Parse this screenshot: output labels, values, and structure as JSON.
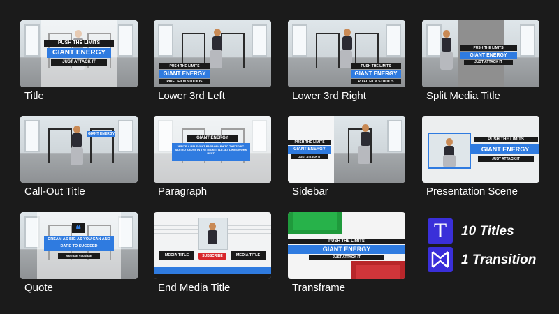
{
  "titles": [
    {
      "caption": "Title"
    },
    {
      "caption": "Lower 3rd Left"
    },
    {
      "caption": "Lower 3rd Right"
    },
    {
      "caption": "Split Media Title"
    },
    {
      "caption": "Call-Out Title"
    },
    {
      "caption": "Paragraph"
    },
    {
      "caption": "Sidebar"
    },
    {
      "caption": "Presentation Scene"
    },
    {
      "caption": "Quote"
    },
    {
      "caption": "End Media Title"
    },
    {
      "caption": "Transframe"
    }
  ],
  "overlay": {
    "line1": "PUSH THE LIMITS",
    "line2": "GIANT ENERGY",
    "line3": "JUST ATTACK IT",
    "studio": "PIXEL FILM STUDIOS",
    "paragraph_body": "WRITE A RELEVANT PARAGRAPH TO THE TOPIC STATED ABOVE IN THE MAIN TITLE. 3-4 LINES WORK BEST.",
    "quote_text": "DREAM AS BIG AS YOU CAN AND DARE TO SUCCEED",
    "quote_author": "Norman Vaughan",
    "end_title": "MEDIA TITLE",
    "subscribe": "SUBSCRIBE"
  },
  "summary": {
    "titles_count": "10 Titles",
    "transition_count": "1 Transition"
  },
  "colors": {
    "background": "#1b1b1b",
    "accent_blue": "#2f7be0",
    "badge": "#3a2fd9"
  },
  "icons": [
    "title-t-icon",
    "transition-bowtie-icon",
    "quote-mark-icon"
  ]
}
